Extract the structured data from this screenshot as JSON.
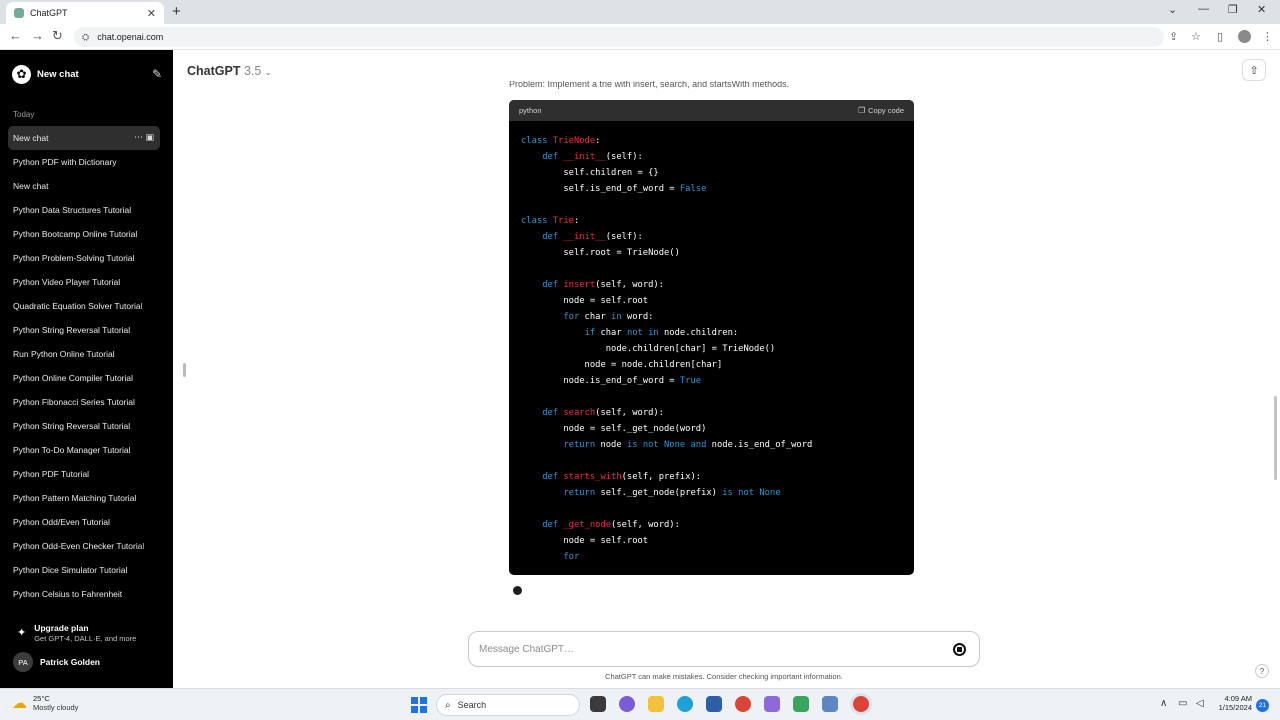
{
  "browser": {
    "tab_title": "ChatGPT",
    "url": "chat.openai.com"
  },
  "sidebar": {
    "new_chat": "New chat",
    "section": "Today",
    "items": [
      {
        "label": "New chat",
        "active": true
      },
      {
        "label": "Python PDF with Dictionary"
      },
      {
        "label": "New chat"
      },
      {
        "label": "Python Data Structures Tutorial"
      },
      {
        "label": "Python Bootcamp Online Tutorial"
      },
      {
        "label": "Python Problem-Solving Tutorial"
      },
      {
        "label": "Python Video Player Tutorial"
      },
      {
        "label": "Quadratic Equation Solver Tutorial"
      },
      {
        "label": "Python String Reversal Tutorial"
      },
      {
        "label": "Run Python Online Tutorial"
      },
      {
        "label": "Python Online Compiler Tutorial"
      },
      {
        "label": "Python Fibonacci Series Tutorial"
      },
      {
        "label": "Python String Reversal Tutorial"
      },
      {
        "label": "Python To-Do Manager Tutorial"
      },
      {
        "label": "Python PDF Tutorial"
      },
      {
        "label": "Python Pattern Matching Tutorial"
      },
      {
        "label": "Python Odd/Even Tutorial"
      },
      {
        "label": "Python Odd-Even Checker Tutorial"
      },
      {
        "label": "Python Dice Simulator Tutorial"
      },
      {
        "label": "Python Celsius to Fahrenheit"
      }
    ],
    "upgrade_title": "Upgrade plan",
    "upgrade_sub": "Get GPT-4, DALL·E, and more",
    "user_initials": "PA",
    "user_name": "Patrick Golden"
  },
  "main": {
    "model_name": "ChatGPT",
    "model_version": "3.5",
    "problem_text": "Problem: Implement a trie with insert, search, and startsWith methods.",
    "code_lang": "python",
    "copy_label": "Copy code",
    "input_placeholder": "Message ChatGPT…",
    "disclaimer": "ChatGPT can make mistakes. Consider checking important information.",
    "help": "?"
  },
  "code_lines": [
    [
      [
        "kw",
        "class "
      ],
      [
        "cls",
        "TrieNode"
      ],
      [
        "",
        ""
      ],
      [
        "",
        ":"
      ]
    ],
    [
      [
        "",
        "    "
      ],
      [
        "kw",
        "def "
      ],
      [
        "fn",
        "__init__"
      ],
      [
        "",
        "(self):"
      ]
    ],
    [
      [
        "",
        "        self.children = {}"
      ]
    ],
    [
      [
        "",
        "        self.is_end_of_word = "
      ],
      [
        "lit",
        "False"
      ]
    ],
    [
      [
        "",
        ""
      ]
    ],
    [
      [
        "kw",
        "class "
      ],
      [
        "cls",
        "Trie"
      ],
      [
        "",
        ":"
      ]
    ],
    [
      [
        "",
        "    "
      ],
      [
        "kw",
        "def "
      ],
      [
        "fn",
        "__init__"
      ],
      [
        "",
        "(self):"
      ]
    ],
    [
      [
        "",
        "        self.root = TrieNode()"
      ]
    ],
    [
      [
        "",
        ""
      ]
    ],
    [
      [
        "",
        "    "
      ],
      [
        "kw",
        "def "
      ],
      [
        "fn",
        "insert"
      ],
      [
        "",
        "(self, word):"
      ]
    ],
    [
      [
        "",
        "        node = self.root"
      ]
    ],
    [
      [
        "",
        "        "
      ],
      [
        "kw",
        "for"
      ],
      [
        "",
        " char "
      ],
      [
        "kw",
        "in"
      ],
      [
        "",
        " word:"
      ]
    ],
    [
      [
        "",
        "            "
      ],
      [
        "kw",
        "if"
      ],
      [
        "",
        " char "
      ],
      [
        "kw",
        "not in"
      ],
      [
        "",
        " node.children:"
      ]
    ],
    [
      [
        "",
        "                node.children[char] = TrieNode()"
      ]
    ],
    [
      [
        "",
        "            node = node.children[char]"
      ]
    ],
    [
      [
        "",
        "        node.is_end_of_word = "
      ],
      [
        "lit",
        "True"
      ]
    ],
    [
      [
        "",
        ""
      ]
    ],
    [
      [
        "",
        "    "
      ],
      [
        "kw",
        "def "
      ],
      [
        "fn",
        "search"
      ],
      [
        "",
        "(self, word):"
      ]
    ],
    [
      [
        "",
        "        node = self._get_node(word)"
      ]
    ],
    [
      [
        "",
        "        "
      ],
      [
        "kw",
        "return"
      ],
      [
        "",
        " node "
      ],
      [
        "kw",
        "is not"
      ],
      [
        " ",
        " "
      ],
      [
        "lit",
        "None"
      ],
      [
        "",
        " "
      ],
      [
        "kw",
        "and"
      ],
      [
        "",
        " node.is_end_of_word"
      ]
    ],
    [
      [
        "",
        ""
      ]
    ],
    [
      [
        "",
        "    "
      ],
      [
        "kw",
        "def "
      ],
      [
        "fn",
        "starts_with"
      ],
      [
        "",
        "(self, prefix):"
      ]
    ],
    [
      [
        "",
        "        "
      ],
      [
        "kw",
        "return"
      ],
      [
        "",
        " self._get_node(prefix) "
      ],
      [
        "kw",
        "is not"
      ],
      [
        "",
        " "
      ],
      [
        "lit",
        "None"
      ]
    ],
    [
      [
        "",
        ""
      ]
    ],
    [
      [
        "",
        "    "
      ],
      [
        "kw",
        "def "
      ],
      [
        "fn",
        "_get_node"
      ],
      [
        "",
        "(self, word):"
      ]
    ],
    [
      [
        "",
        "        node = self.root"
      ]
    ],
    [
      [
        "",
        "        "
      ],
      [
        "kw",
        "for"
      ]
    ]
  ],
  "taskbar": {
    "temp": "25°C",
    "weather": "Mostly cloudy",
    "search": "Search",
    "time": "4:09 AM",
    "date": "1/15/2024",
    "notifications": "21"
  },
  "colors": {
    "keyword": "#2e95d3",
    "classname": "#f22c3d",
    "sidebar_bg": "#000000"
  }
}
